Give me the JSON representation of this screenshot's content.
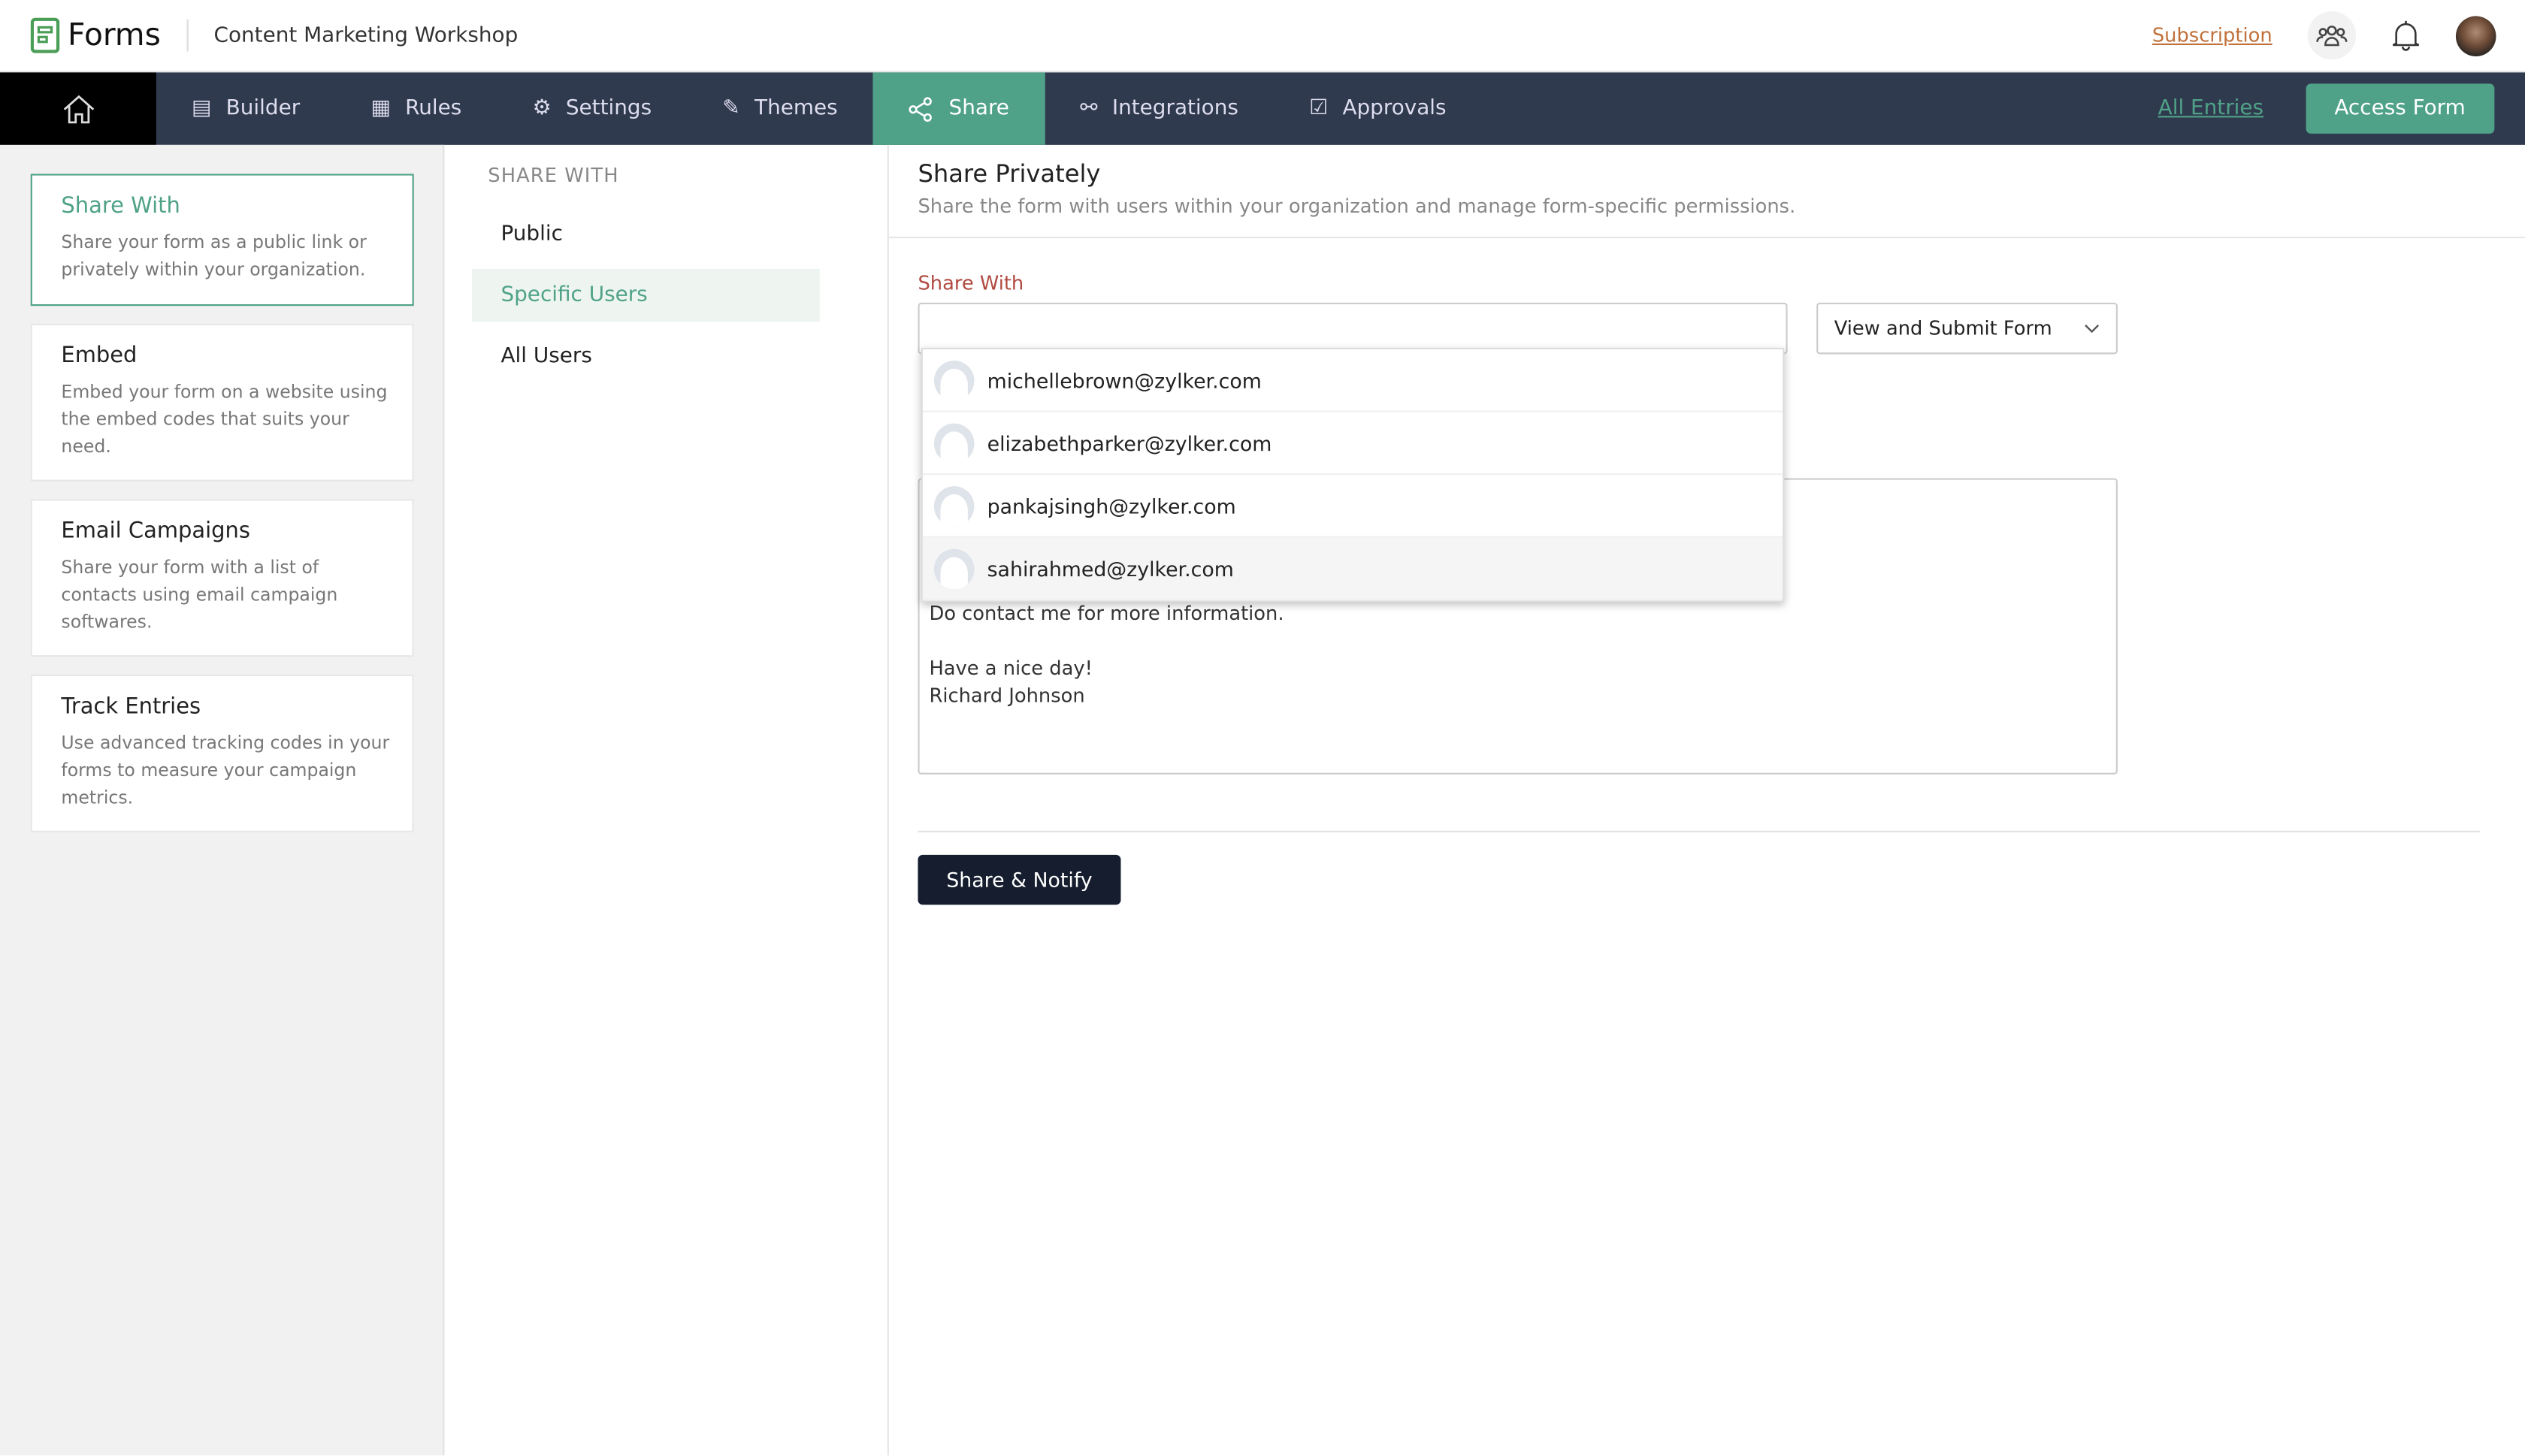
{
  "header": {
    "app_name": "Forms",
    "form_title": "Content Marketing Workshop",
    "subscription": "Subscription"
  },
  "nav": {
    "items": [
      {
        "label": "Builder",
        "icon": "builder-icon"
      },
      {
        "label": "Rules",
        "icon": "rules-icon"
      },
      {
        "label": "Settings",
        "icon": "gear-icon"
      },
      {
        "label": "Themes",
        "icon": "brush-icon"
      },
      {
        "label": "Share",
        "icon": "share-icon",
        "active": true
      },
      {
        "label": "Integrations",
        "icon": "integrations-icon"
      },
      {
        "label": "Approvals",
        "icon": "approvals-icon"
      }
    ],
    "all_entries": "All Entries",
    "access_form": "Access Form"
  },
  "left": {
    "cards": [
      {
        "title": "Share With",
        "desc": "Share your form as a public link or privately within your organization.",
        "active": true
      },
      {
        "title": "Embed",
        "desc": "Embed your form on a website using the embed codes that suits your need."
      },
      {
        "title": "Email Campaigns",
        "desc": "Share your form with a list of contacts using email campaign softwares."
      },
      {
        "title": "Track Entries",
        "desc": "Use advanced tracking codes in your forms to measure your campaign metrics."
      }
    ]
  },
  "middle": {
    "heading": "SHARE WITH",
    "items": [
      {
        "label": "Public"
      },
      {
        "label": "Specific Users",
        "active": true
      },
      {
        "label": "All Users"
      }
    ]
  },
  "main": {
    "title": "Share Privately",
    "description": "Share the form with users within your organization and manage form-specific permissions.",
    "share_with_label": "Share With",
    "permission": "View and Submit Form",
    "suggestions": [
      "michellebrown@zylker.com",
      "elizabethparker@zylker.com",
      "pankajsingh@zylker.com",
      "sahirahmed@zylker.com"
    ],
    "message_lines": [
      "Do contact me for more information.",
      "Have a nice day!",
      "Richard Johnson"
    ],
    "share_button": "Share & Notify"
  },
  "colors": {
    "accent": "#4fa288",
    "nav_bg": "#303a4e",
    "label_red": "#b04a40",
    "subscription": "#c0703a"
  }
}
